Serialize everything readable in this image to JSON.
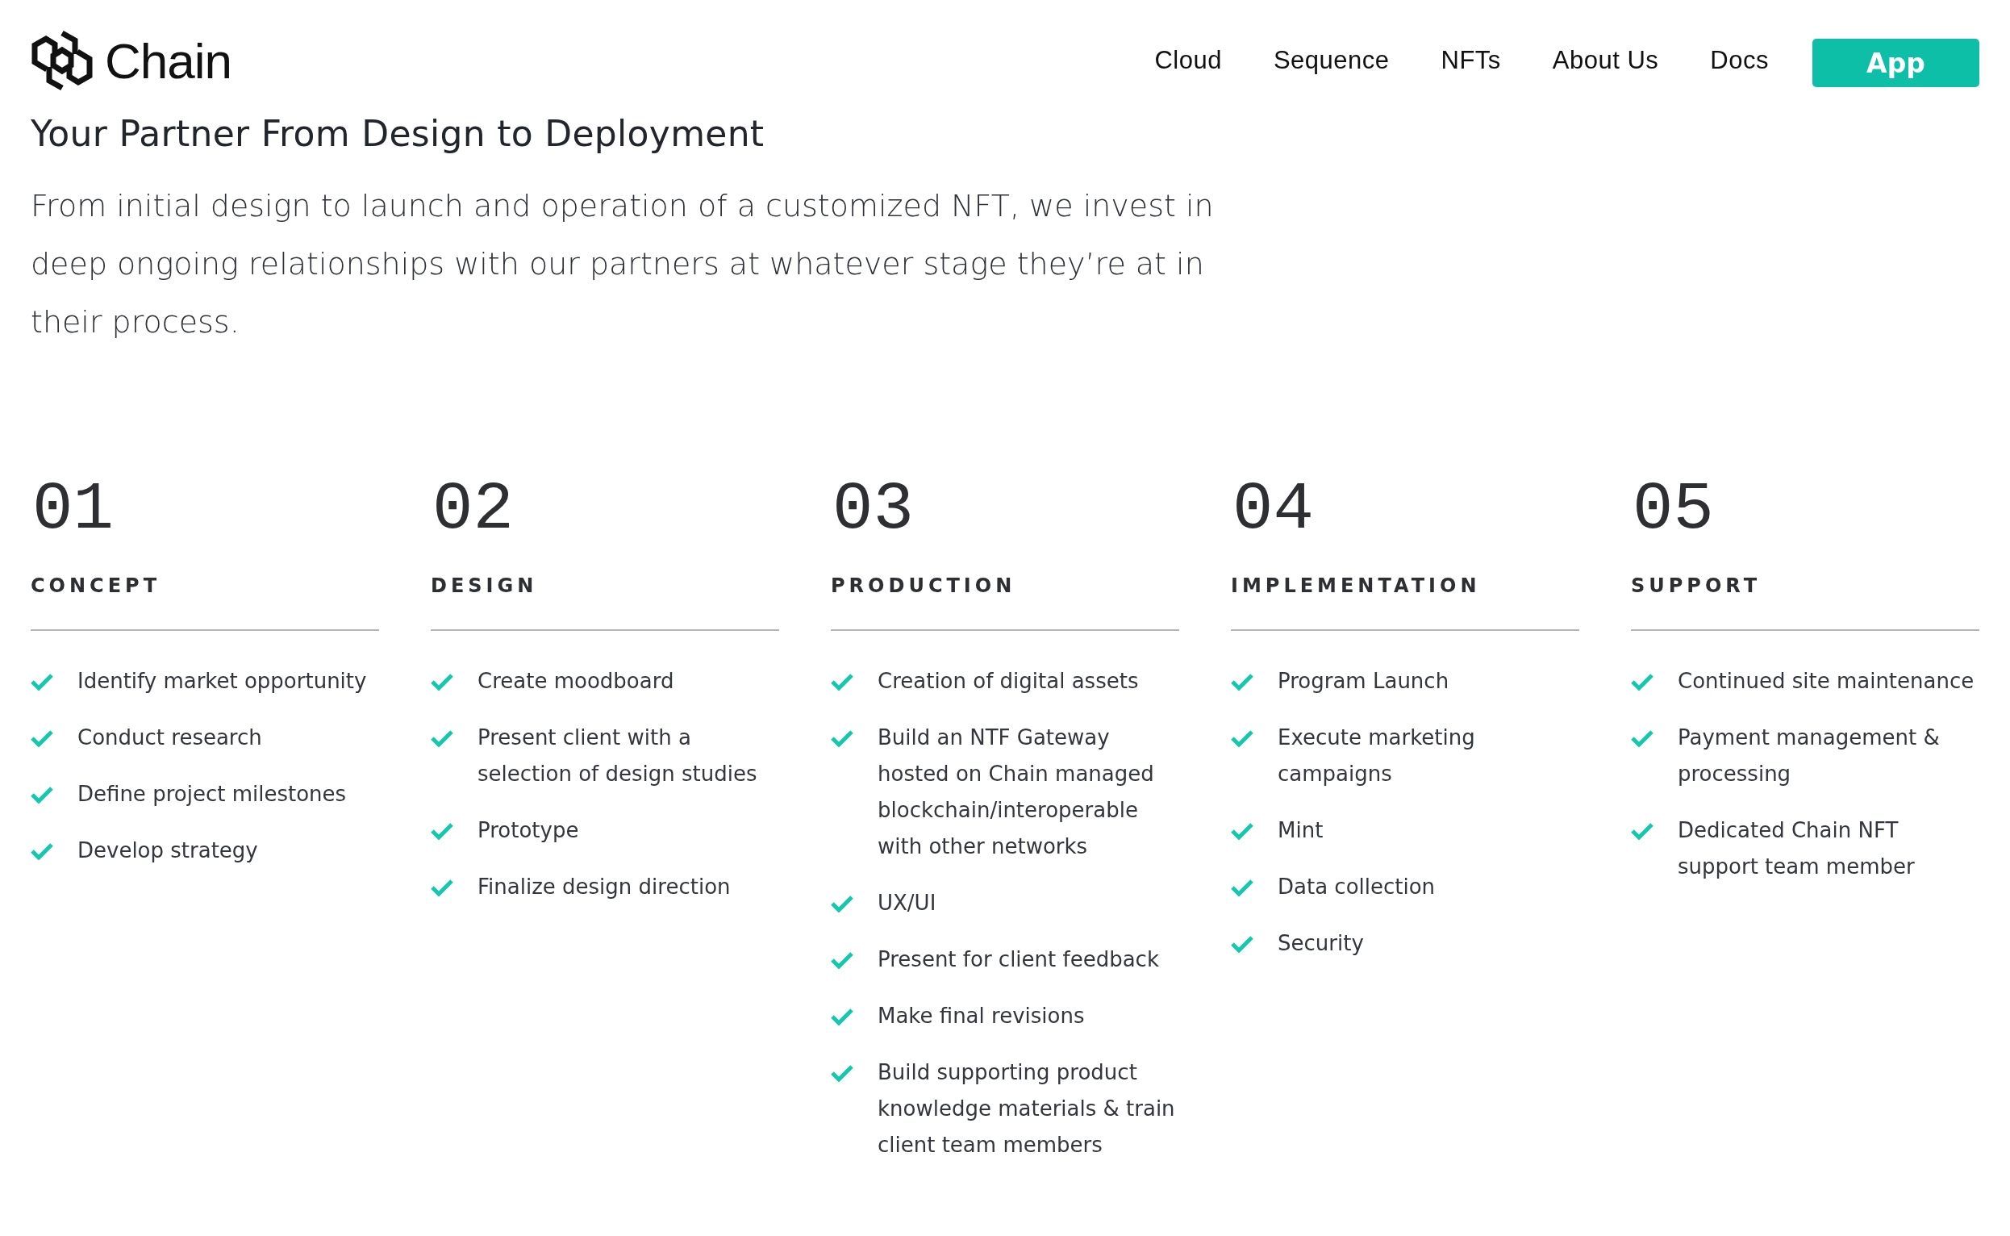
{
  "header": {
    "logo": "Chain",
    "nav": [
      {
        "label": "Cloud"
      },
      {
        "label": "Sequence"
      },
      {
        "label": "NFTs"
      },
      {
        "label": "About Us"
      },
      {
        "label": "Docs"
      }
    ],
    "cta": "App"
  },
  "title": "Your Partner From Design to Deployment",
  "intro": "From initial design to launch and operation of a customized NFT, we invest in deep ongoing relationships with our partners at whatever stage they’re at in their process.",
  "steps": [
    {
      "number": "01",
      "name": "CONCEPT",
      "items": [
        "Identify market opportunity",
        "Conduct research",
        "Define project milestones",
        "Develop strategy"
      ]
    },
    {
      "number": "02",
      "name": "DESIGN",
      "items": [
        "Create moodboard",
        "Present client with a selection of design studies",
        "Prototype",
        "Finalize design direction"
      ]
    },
    {
      "number": "03",
      "name": "PRODUCTION",
      "items": [
        "Creation of digital assets",
        "Build an NTF Gateway hosted on Chain managed blockchain/interoperable with other networks",
        "UX/UI",
        "Present for client feedback",
        "Make final revisions",
        "Build supporting product knowledge materials & train client team members"
      ]
    },
    {
      "number": "04",
      "name": "IMPLEMENTATION",
      "items": [
        "Program Launch",
        "Execute marketing campaigns",
        "Mint",
        "Data collection",
        "Security"
      ]
    },
    {
      "number": "05",
      "name": "SUPPORT",
      "items": [
        "Continued site maintenance",
        "Payment management & processing",
        "Dedicated Chain NFT support team member"
      ]
    }
  ]
}
